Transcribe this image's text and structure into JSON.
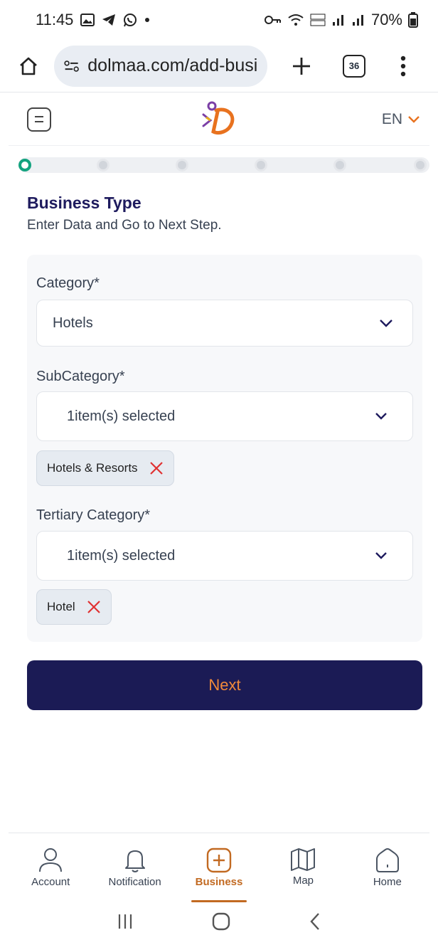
{
  "status_bar": {
    "time": "11:45",
    "battery": "70%"
  },
  "browser": {
    "url": "dolmaa.com/add-business",
    "tab_count": "36"
  },
  "header": {
    "language": "EN"
  },
  "steps": {
    "total": 6,
    "current": 1
  },
  "page": {
    "title": "Business Type",
    "subtitle": "Enter Data and Go to Next Step."
  },
  "form": {
    "category": {
      "label": "Category*",
      "value": "Hotels"
    },
    "subcategory": {
      "label": "SubCategory*",
      "value": "1item(s) selected",
      "chips": [
        "Hotels & Resorts"
      ]
    },
    "tertiary": {
      "label": "Tertiary Category*",
      "value": "1item(s) selected",
      "chips": [
        "Hotel"
      ]
    }
  },
  "actions": {
    "next_label": "Next"
  },
  "bottom_nav": {
    "items": [
      {
        "label": "Account",
        "icon": "person-icon"
      },
      {
        "label": "Notification",
        "icon": "bell-icon"
      },
      {
        "label": "Business",
        "icon": "plus-square-icon"
      },
      {
        "label": "Map",
        "icon": "map-icon"
      },
      {
        "label": "Home",
        "icon": "home-icon"
      }
    ],
    "active": "Business"
  },
  "colors": {
    "primary": "#1b1b55",
    "accent": "#f18a3a",
    "active_step": "#14a37f",
    "chip_close": "#e03131"
  }
}
